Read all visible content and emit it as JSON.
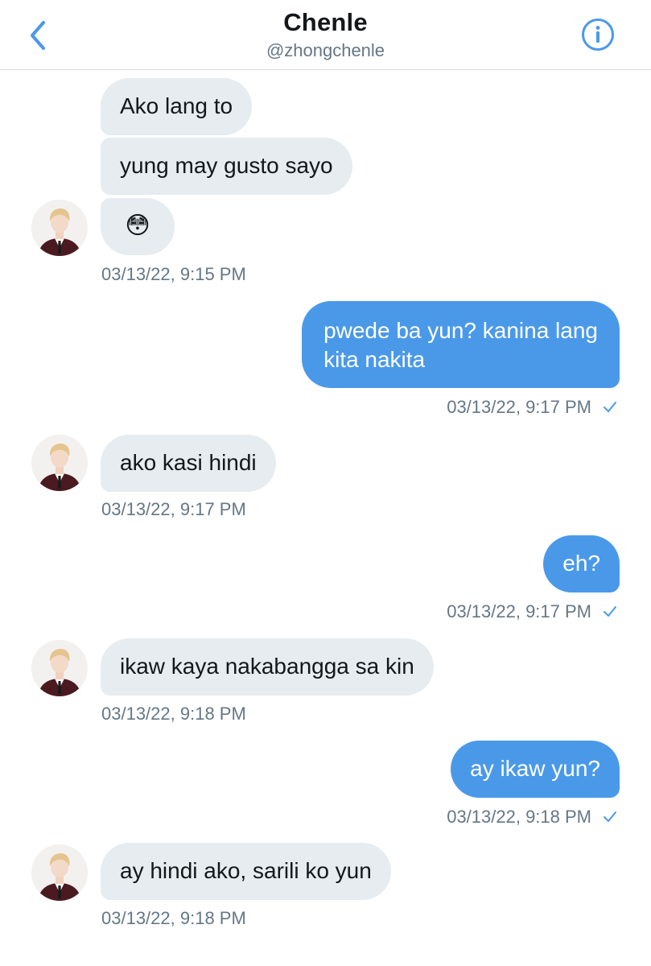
{
  "header": {
    "title": "Chenle",
    "handle": "@zhongchenle",
    "back_icon": "chevron-left-icon",
    "info_icon": "info-circle-icon"
  },
  "colors": {
    "accent": "#4a99e9",
    "incoming_bubble": "#e6ecf0",
    "timestamp": "#657786"
  },
  "messages": [
    {
      "dir": "in",
      "text": "Ako lang to"
    },
    {
      "dir": "in",
      "text": "yung may gusto sayo"
    },
    {
      "dir": "in",
      "text": "😳"
    },
    {
      "dir": "in",
      "timestamp": "03/13/22, 9:15 PM"
    },
    {
      "dir": "out",
      "line1": "pwede ba yun? kanina lang",
      "line2": "kita nakita"
    },
    {
      "dir": "out",
      "timestamp": "03/13/22, 9:17 PM"
    },
    {
      "dir": "in",
      "text": "ako kasi hindi"
    },
    {
      "dir": "in",
      "timestamp": "03/13/22, 9:17 PM"
    },
    {
      "dir": "out",
      "text": "eh?"
    },
    {
      "dir": "out",
      "timestamp": "03/13/22, 9:17 PM"
    },
    {
      "dir": "in",
      "text": "ikaw kaya nakabangga sa kin"
    },
    {
      "dir": "in",
      "timestamp": "03/13/22, 9:18 PM"
    },
    {
      "dir": "out",
      "text": "ay ikaw yun?"
    },
    {
      "dir": "out",
      "timestamp": "03/13/22, 9:18 PM"
    },
    {
      "dir": "in",
      "text": "ay hindi ako, sarili ko yun"
    },
    {
      "dir": "in",
      "timestamp": "03/13/22, 9:18 PM"
    }
  ]
}
